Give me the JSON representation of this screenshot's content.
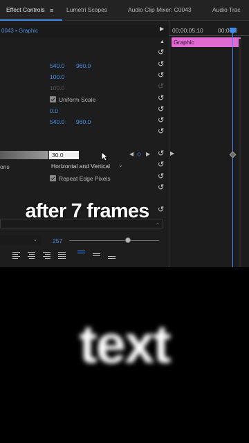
{
  "tabs": [
    {
      "label": "Effect Controls",
      "active": true
    },
    {
      "label": "Lumetri Scopes",
      "active": false
    },
    {
      "label": "Audio Clip Mixer: C0043",
      "active": false
    },
    {
      "label": "Audio Trac",
      "active": false
    }
  ],
  "menu_glyph": "≡",
  "clip_header": "0043 • Graphic",
  "timeline": {
    "timecode_1": "00;00;05;10",
    "timecode_2": "00;00;0",
    "clip_label": "Graphic",
    "colors": {
      "clip": "#e069d2",
      "playhead": "#3d8bf0"
    }
  },
  "properties": {
    "position": {
      "x": "540.0",
      "y": "960.0"
    },
    "scale": "100.0",
    "scale_width": "100.0",
    "uniform_scale_label": "Uniform Scale",
    "rotation": "0.0",
    "anchor": {
      "x": "540.0",
      "y": "960.0"
    },
    "blurriness": "30.0",
    "blur_dimensions_partial_label": "ons",
    "blur_dimensions": "Horizontal and Vertical",
    "repeat_edge_label": "Repeat Edge Pixels"
  },
  "caption": "after 7 frames",
  "font_size": "257",
  "preview_text": "text",
  "icons": {
    "reset": "↺",
    "play": "▶",
    "up": "▲",
    "kf_prev": "◀",
    "kf_next": "▶",
    "kf_add": "◇",
    "chevron": "⌄"
  }
}
